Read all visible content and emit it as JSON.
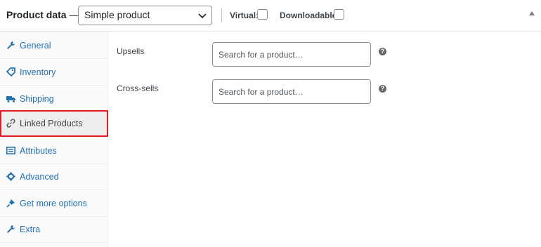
{
  "header": {
    "title": "Product data",
    "dash": "—",
    "product_type": "Simple product",
    "virtual_label": "Virtual:",
    "downloadable_label": "Downloadable:",
    "virtual_checked": false,
    "downloadable_checked": false
  },
  "tabs": [
    {
      "label": "General",
      "icon": "wrench-icon",
      "active": false
    },
    {
      "label": "Inventory",
      "icon": "tag-icon",
      "active": false
    },
    {
      "label": "Shipping",
      "icon": "truck-icon",
      "active": false
    },
    {
      "label": "Linked Products",
      "icon": "link-icon",
      "active": true
    },
    {
      "label": "Attributes",
      "icon": "list-icon",
      "active": false
    },
    {
      "label": "Advanced",
      "icon": "gear-icon",
      "active": false
    },
    {
      "label": "Get more options",
      "icon": "plugin-icon",
      "active": false
    },
    {
      "label": "Extra",
      "icon": "wrench-icon",
      "active": false
    }
  ],
  "panel": {
    "upsells": {
      "label": "Upsells",
      "placeholder": "Search for a product…",
      "value": ""
    },
    "cross_sells": {
      "label": "Cross-sells",
      "placeholder": "Search for a product…",
      "value": ""
    },
    "help_glyph": "?"
  },
  "colors": {
    "link": "#2271b1",
    "active_outline": "#e01b24",
    "sidebar_bg": "#fafafa",
    "active_bg": "#eeeeee"
  }
}
